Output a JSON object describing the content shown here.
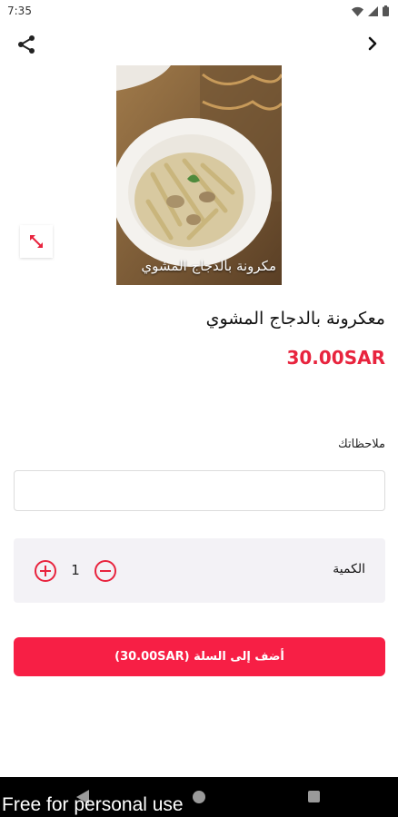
{
  "status_bar": {
    "time": "7:35"
  },
  "product": {
    "title": "معكرونة بالدجاج المشوي",
    "price": "30.00SAR",
    "image_caption": "مكرونة بالدجاج المشوي"
  },
  "notes": {
    "label": "ملاحظاتك",
    "value": "",
    "placeholder": ""
  },
  "quantity": {
    "label": "الكمية",
    "value": "1"
  },
  "cart": {
    "button_label": "أضف إلى السلة (30.00SAR)"
  },
  "watermark": "Free for personal use",
  "colors": {
    "accent": "#e8243e",
    "button": "#f71f45",
    "qty_background": "#f3f2f6"
  },
  "icons": [
    "share-icon",
    "chevron-right-icon",
    "expand-icon",
    "plus-circle-icon",
    "minus-circle-icon",
    "wifi-icon",
    "signal-icon",
    "battery-icon"
  ]
}
